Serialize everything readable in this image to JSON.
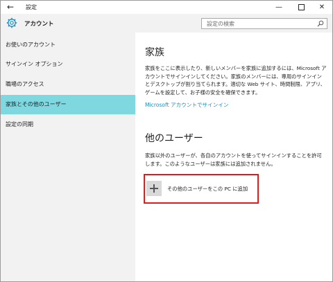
{
  "window": {
    "title": "設定",
    "back_icon": "back-arrow-icon",
    "minimize_icon": "minimize-icon",
    "maximize_icon": "maximize-icon",
    "close_icon": "close-icon"
  },
  "header": {
    "icon": "gear-icon",
    "title": "アカウント",
    "search_placeholder": "設定の検索",
    "search_icon": "search-icon"
  },
  "sidebar": {
    "items": [
      {
        "label": "お使いのアカウント",
        "active": false
      },
      {
        "label": "サインイン オプション",
        "active": false
      },
      {
        "label": "職場のアクセス",
        "active": false
      },
      {
        "label": "家族とその他のユーザー",
        "active": true
      },
      {
        "label": "設定の同期",
        "active": false
      }
    ],
    "active_color": "#7fd7e0"
  },
  "main": {
    "family": {
      "title": "家族",
      "description": "家族をここに表示したり、新しいメンバーを家族に追加するには、Microsoft アカウントでサインインしてください。家族のメンバーには、専用のサインインとデスクトップが割り当てられます。適切な Web サイト、時間制限、アプリ、ゲームを設定して、お子様の安全を確保できます。",
      "link": "Microsoft アカウントでサインイン"
    },
    "other_users": {
      "title": "他のユーザー",
      "description": "家族以外のユーザーが、各自のアカウントを使ってサインインすることを許可します。このようなユーザーは家族には追加されません。",
      "add_button_label": "その他のユーザーをこの PC に追加",
      "add_icon": "plus-icon"
    }
  },
  "colors": {
    "link": "#1a8fbf",
    "highlight_border": "#e11b1b"
  }
}
